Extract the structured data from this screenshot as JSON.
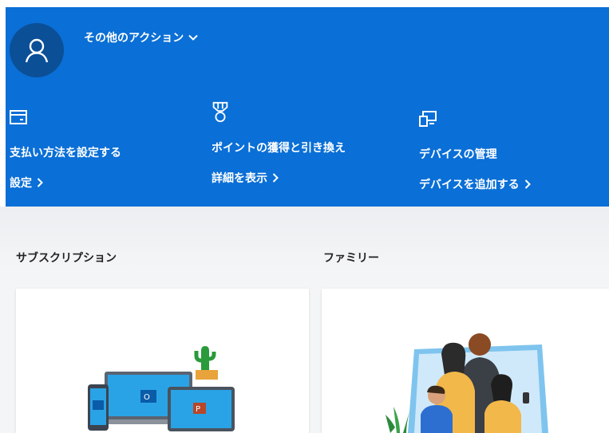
{
  "header": {
    "more_actions_label": "その他のアクション",
    "actions": [
      {
        "icon": "credit-card-icon",
        "title": "支払い方法を設定する",
        "link": "設定"
      },
      {
        "icon": "rewards-medal-icon",
        "title": "ポイントの獲得と引き換え",
        "link": "詳細を表示"
      },
      {
        "icon": "devices-icon",
        "title": "デバイスの管理",
        "link": "デバイスを追加する"
      }
    ]
  },
  "sections": [
    {
      "title": "サブスクリプション"
    },
    {
      "title": "ファミリー"
    }
  ],
  "colors": {
    "brand_blue": "#0a6fd6",
    "avatar_blue": "#0b4f97",
    "page_bg": "#f4f5f6"
  }
}
